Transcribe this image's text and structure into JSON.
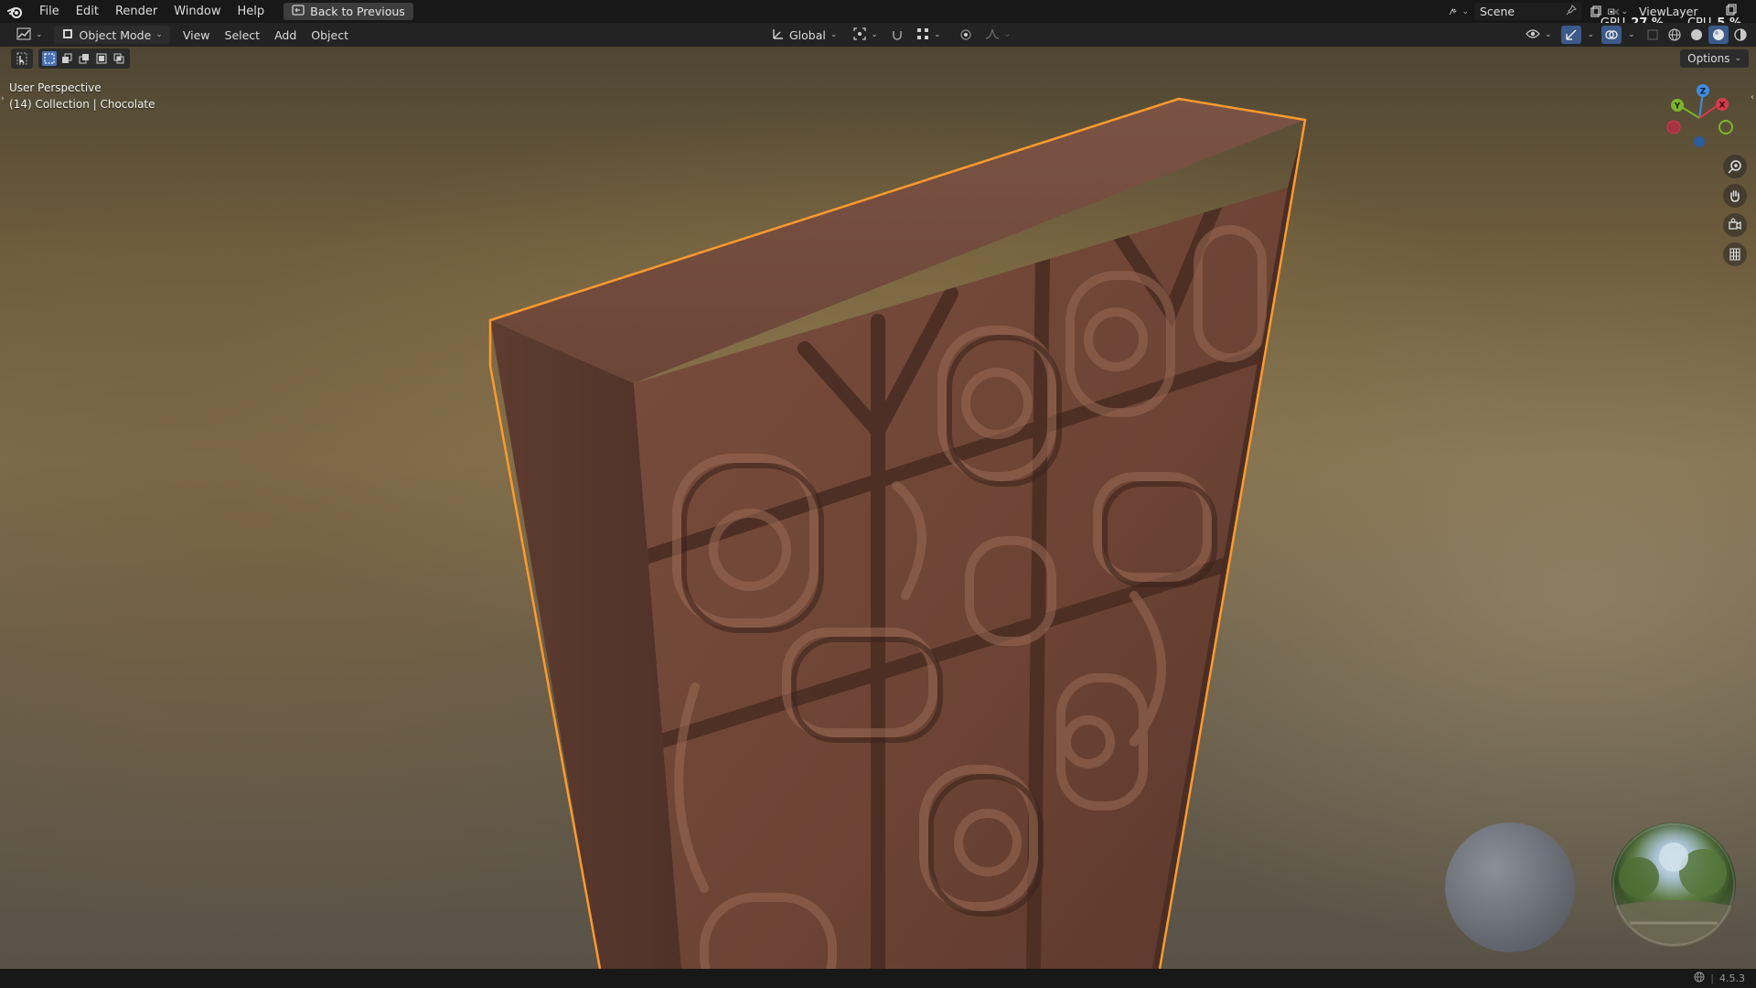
{
  "topbar": {
    "menu": [
      "File",
      "Edit",
      "Render",
      "Window",
      "Help"
    ],
    "back_button": "Back to Previous",
    "scene_name": "Scene",
    "view_layer": "ViewLayer"
  },
  "stats": {
    "gpu_label": "GPU",
    "gpu_value": "27 %",
    "cpu_label": "CPU",
    "cpu_value": "5 %"
  },
  "header": {
    "mode": "Object Mode",
    "menu": [
      "View",
      "Select",
      "Add",
      "Object"
    ],
    "transform_orientation": "Global"
  },
  "viewport": {
    "options_label": "Options",
    "view_name": "User Perspective",
    "collection_info": "(14) Collection | Chocolate",
    "gizmo_axes": {
      "x": "X",
      "y": "Y",
      "z": "Z"
    },
    "axis_colors": {
      "x": "#d6394b",
      "y": "#7bb62a",
      "z": "#3f8de0"
    },
    "selection_outline_color": "#ff9a2e",
    "object_color": "#6e4535"
  },
  "status": {
    "version": "4.5.3"
  },
  "icons": [
    "blender-logo-icon",
    "back-icon",
    "editor-type-icon",
    "object-mode-icon",
    "scene-icon",
    "pin-icon",
    "new-scene-icon",
    "close-icon",
    "view-layer-icon",
    "orientation-icon",
    "pivot-icon",
    "snap-icon",
    "snap-target-icon",
    "proportional-icon",
    "visibility-icon",
    "gizmo-icon",
    "overlay-icon",
    "xray-icon",
    "shading-wireframe-icon",
    "shading-solid-icon",
    "shading-material-icon",
    "shading-rendered-icon",
    "select-box-icon",
    "zoom-icon",
    "pan-hand-icon",
    "camera-icon",
    "grid-icon",
    "globe-icon"
  ]
}
